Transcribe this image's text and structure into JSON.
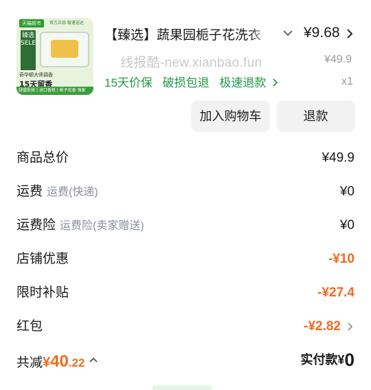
{
  "product": {
    "thumbnail": {
      "tmall_tag": "天猫超市",
      "tag2": "官方正品 极速送达",
      "brand": "臻选SELECT",
      "line1": "奇华顿大师调香",
      "headline": "15天留香",
      "bottom_bar": "绿盟肤抹 | 进口香氛 | 栀子花香 独家"
    },
    "title": "【臻选】蔬果园栀子花洗衣",
    "price": "¥9.68",
    "original_price": "¥49.9",
    "watermark": "线报酷-new.xianbao.fun",
    "services": [
      "15天价保",
      "破损包退",
      "极速退款"
    ],
    "quantity": "x1"
  },
  "buttons": {
    "add_to_cart": "加入购物车",
    "refund": "退款"
  },
  "summary": {
    "goods_total_label": "商品总价",
    "goods_total_value": "¥49.9",
    "shipping_label": "运费",
    "shipping_sub": "运费(快递)",
    "shipping_value": "¥0",
    "shipping_insurance_label": "运费险",
    "shipping_insurance_sub": "运费险(卖家赠送)",
    "shipping_insurance_value": "¥0",
    "store_discount_label": "店铺优惠",
    "store_discount_value": "-¥10",
    "limited_subsidy_label": "限时补贴",
    "limited_subsidy_value": "-¥27.4",
    "red_packet_label": "红包",
    "red_packet_value": "-¥2.82"
  },
  "footer": {
    "total_saved_label": "共减",
    "total_saved_currency": "¥",
    "total_saved_int": "40",
    "total_saved_dec": ".22",
    "paid_label": "实付款",
    "paid_currency": "¥",
    "paid_amount": "0"
  },
  "colors": {
    "service_green": "#1f9a45",
    "discount_orange": "#f06a1f",
    "sub_label_gray": "#8a8fa0"
  },
  "icons": [
    "chevron-down-icon",
    "chevron-right-icon",
    "chevron-up-icon"
  ]
}
